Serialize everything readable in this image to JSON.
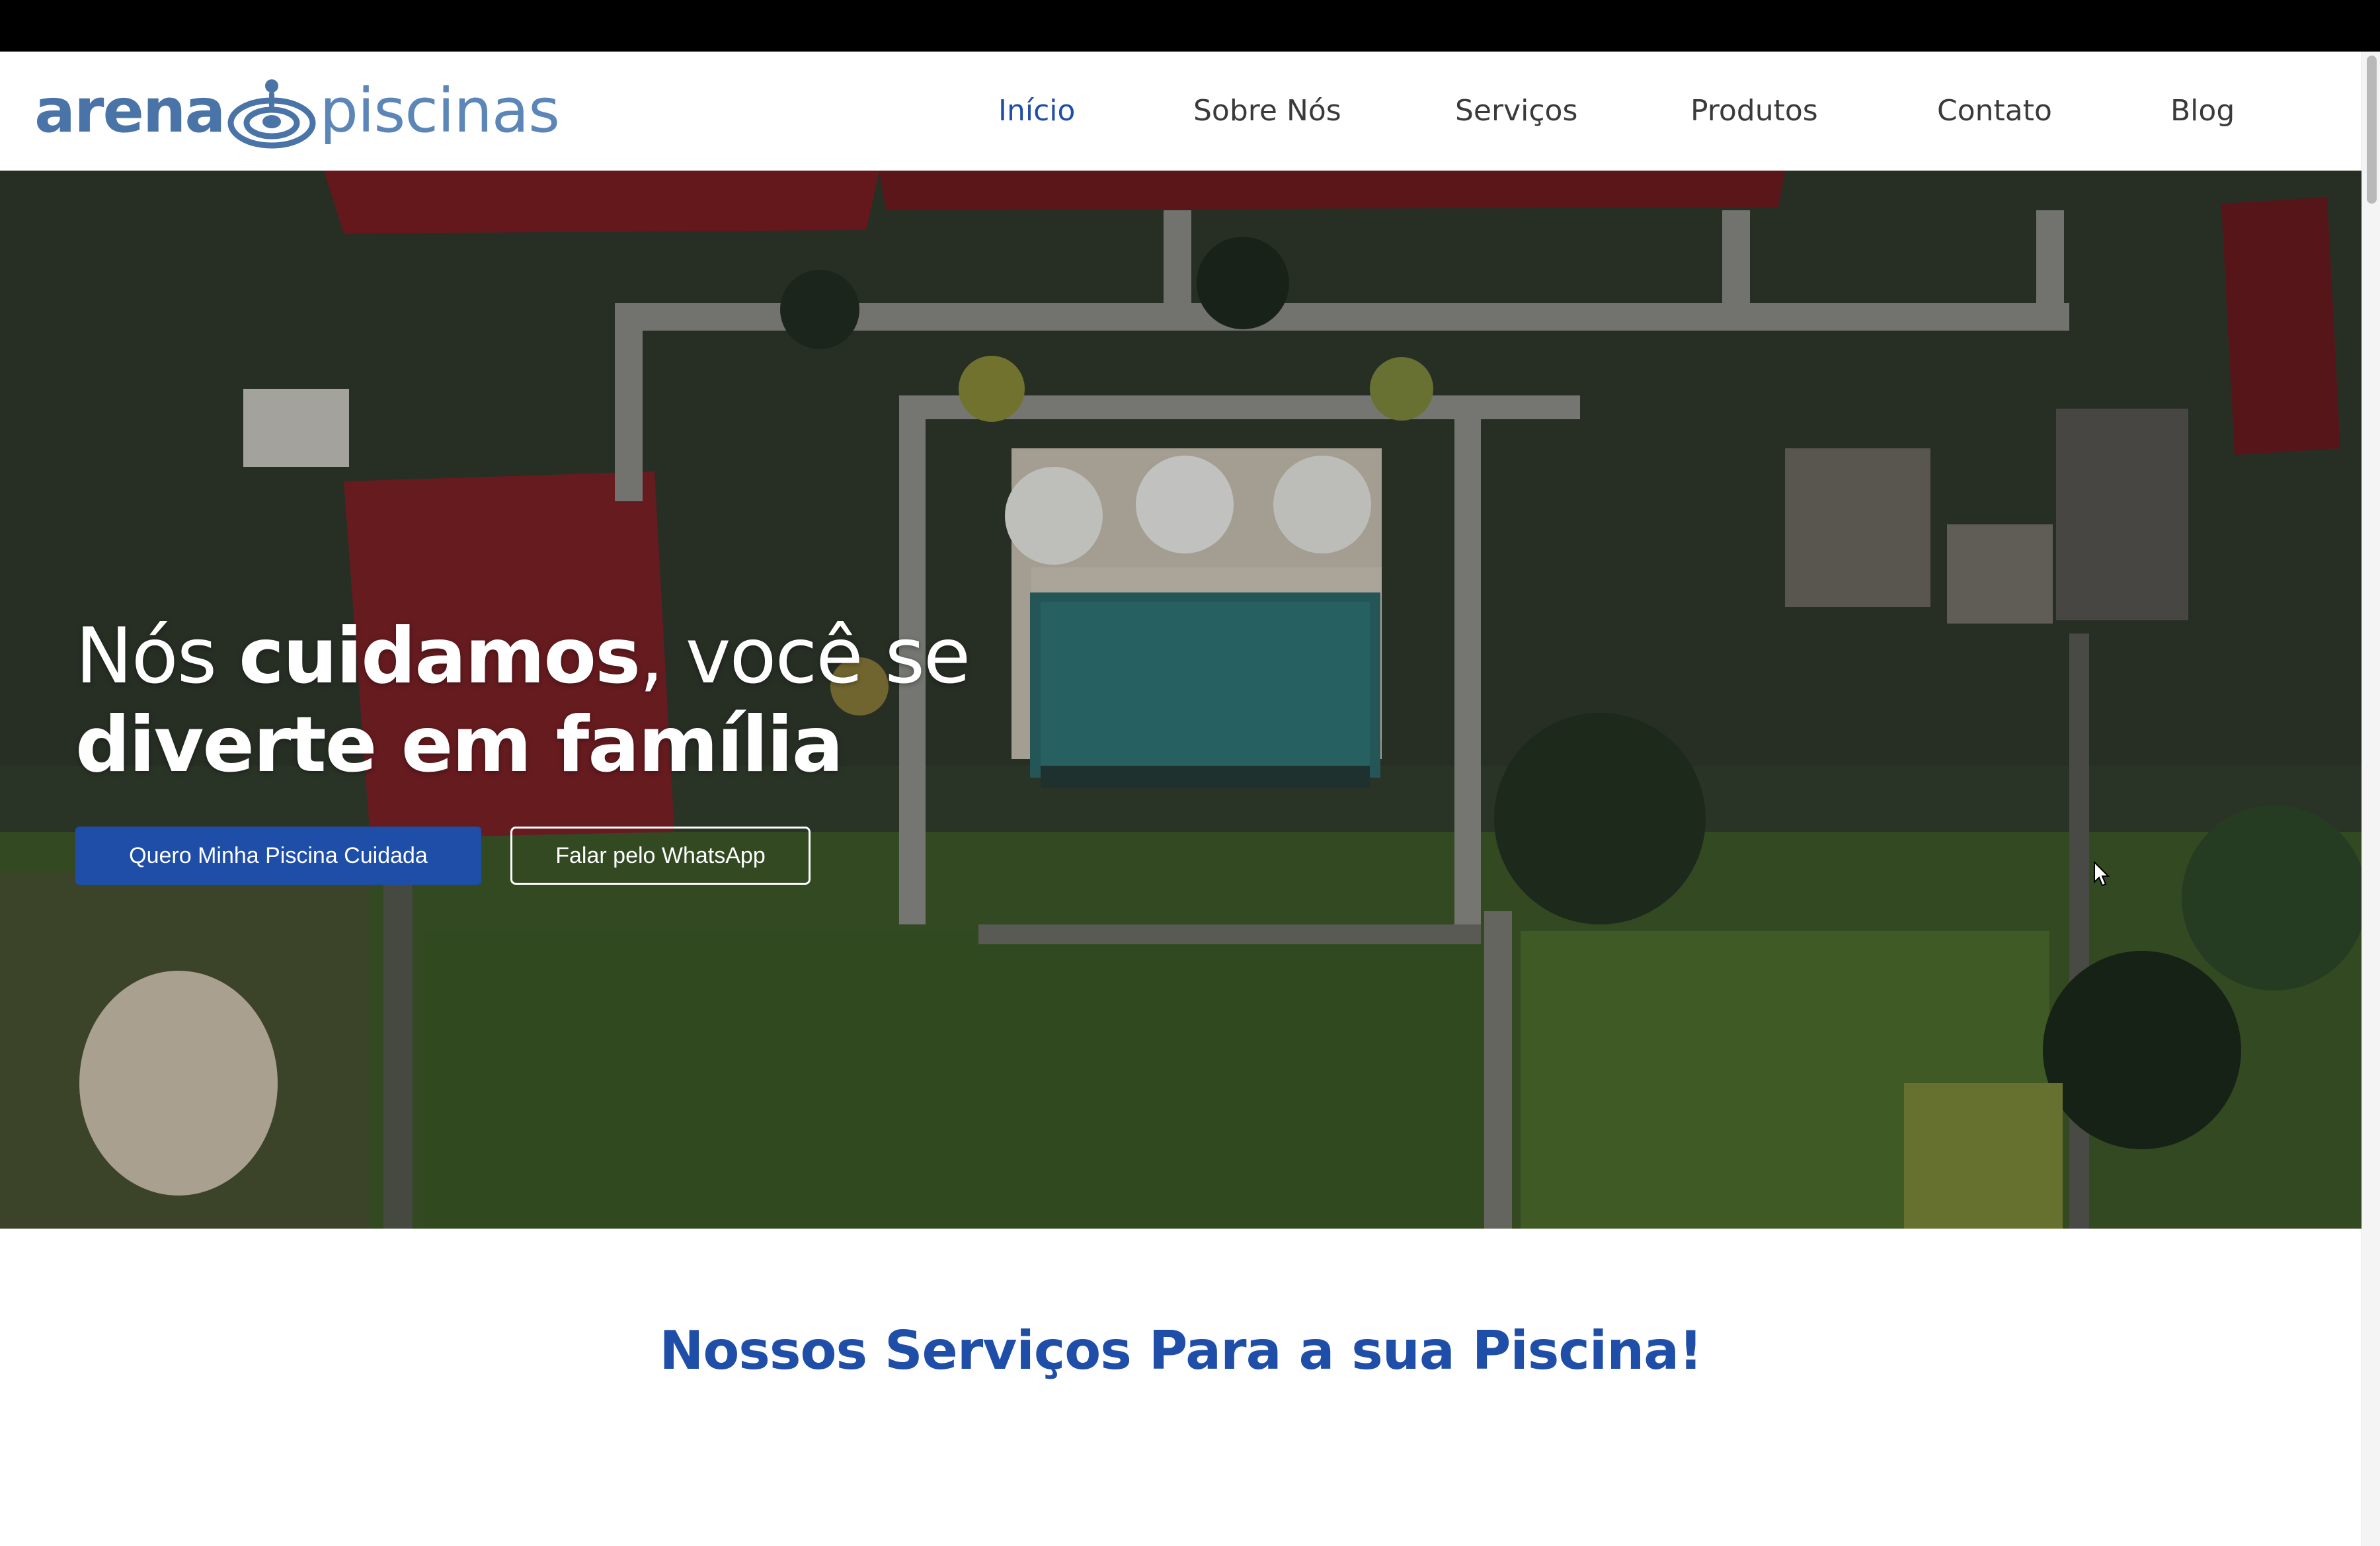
{
  "brand": {
    "logo_part1": "arena",
    "logo_part2": "piscinas",
    "logo_color": "#4a74a8"
  },
  "nav": {
    "items": [
      {
        "label": "Início",
        "active": true
      },
      {
        "label": "Sobre Nós",
        "active": false
      },
      {
        "label": "Serviços",
        "active": false
      },
      {
        "label": "Produtos",
        "active": false
      },
      {
        "label": "Contato",
        "active": false
      },
      {
        "label": "Blog",
        "active": false
      }
    ],
    "active_color": "#1f4ea8",
    "text_color": "#3a3a3a"
  },
  "hero": {
    "title_line1_a": "Nós ",
    "title_line1_b": "cuidamos",
    "title_line1_c": ", você se",
    "title_line2": "diverte em família",
    "primary_button": "Quero Minha Piscina Cuidada",
    "secondary_button": "Falar pelo WhatsApp",
    "primary_color": "#1f4ea8"
  },
  "services": {
    "heading": "Nossos Serviços Para a sua Piscina!"
  }
}
